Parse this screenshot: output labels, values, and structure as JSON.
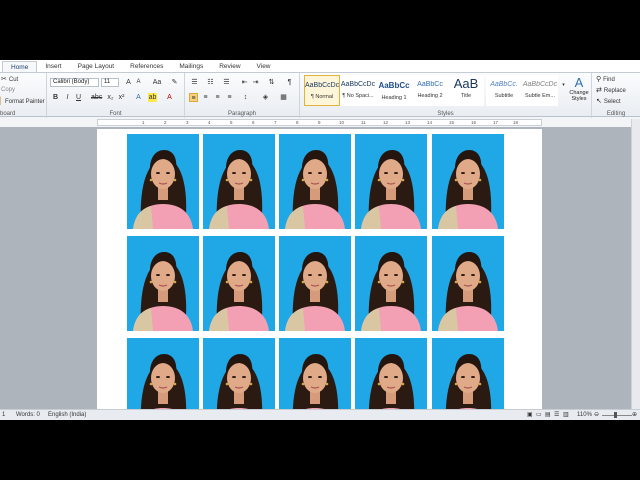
{
  "tabs": [
    "Home",
    "Insert",
    "Page Layout",
    "References",
    "Mailings",
    "Review",
    "View"
  ],
  "clipboard": {
    "cut": "Cut",
    "copy": "Copy",
    "format_painter": "Format Painter",
    "label": "board"
  },
  "font": {
    "name": "Calibri (Body)",
    "size": "11",
    "label": "Font"
  },
  "paragraph": {
    "label": "Paragraph"
  },
  "styles": {
    "label": "Styles",
    "items": [
      {
        "sample": "AaBbCcDc",
        "name": "¶ Normal"
      },
      {
        "sample": "AaBbCcDc",
        "name": "¶ No Spaci..."
      },
      {
        "sample": "AaBbCc",
        "name": "Heading 1"
      },
      {
        "sample": "AaBbCc",
        "name": "Heading 2"
      },
      {
        "sample": "AaB",
        "name": "Title"
      },
      {
        "sample": "AaBbCc.",
        "name": "Subtitle"
      },
      {
        "sample": "AaBbCcDc",
        "name": "Subtle Em..."
      }
    ],
    "change_styles": "Change Styles"
  },
  "editing": {
    "find": "Find",
    "replace": "Replace",
    "select": "Select",
    "label": "Editing"
  },
  "ruler": {
    "numbers": [
      "1",
      "2",
      "3",
      "4",
      "5",
      "6",
      "7",
      "8",
      "9",
      "10",
      "11",
      "12",
      "13",
      "14",
      "15",
      "16",
      "17",
      "18"
    ]
  },
  "status": {
    "page": "1",
    "words": "Words: 0",
    "language": "English (India)",
    "zoom": "110%"
  },
  "photo_grid": {
    "rows": 3,
    "cols": 5,
    "background": "#1fa7e6",
    "shirt": "#f3a0b4"
  }
}
